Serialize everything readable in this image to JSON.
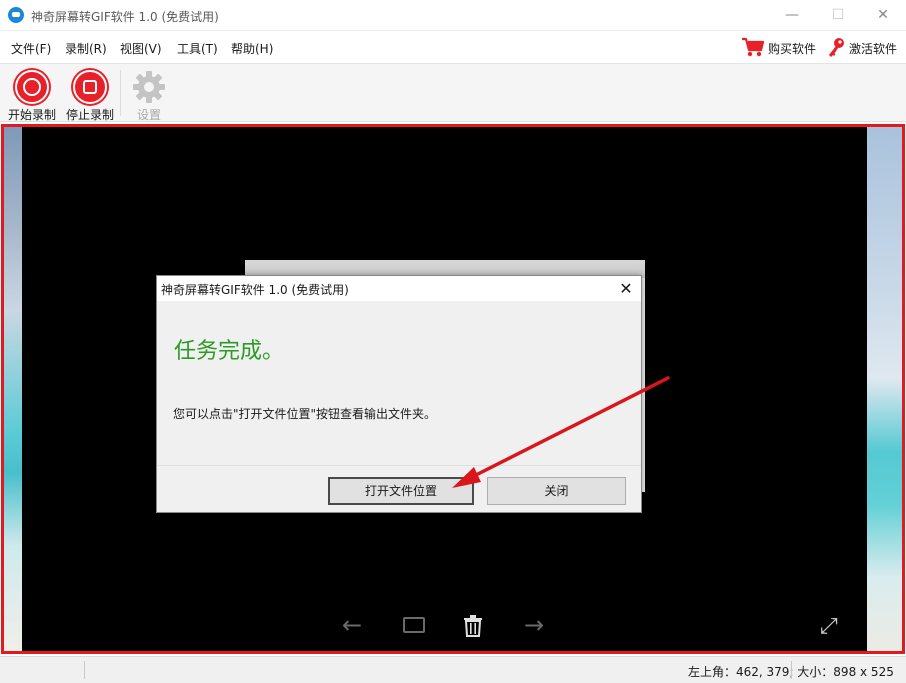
{
  "window": {
    "title": "神奇屏幕转GIF软件 1.0 (免费试用)",
    "minimize_glyph": "—",
    "maximize_glyph": "☐",
    "close_glyph": "✕"
  },
  "menu": {
    "file": "文件(F)",
    "record": "录制(R)",
    "view": "视图(V)",
    "tools": "工具(T)",
    "help": "帮助(H)",
    "buy": "购买软件",
    "activate": "激活软件"
  },
  "toolbar": {
    "start": "开始录制",
    "stop": "停止录制",
    "settings": "设置"
  },
  "dialog": {
    "title": "神奇屏幕转GIF软件 1.0 (免费试用)",
    "heading": "任务完成。",
    "message": "您可以点击\"打开文件位置\"按钮查看输出文件夹。",
    "open_folder": "打开文件位置",
    "close": "关闭"
  },
  "nav": {
    "prev_glyph": "←",
    "next_glyph": "→",
    "fullscreen_glyph": "⤢"
  },
  "status": {
    "text": "左上角：462, 379; 大小：898 x 525"
  },
  "colors": {
    "record_red": "#e8202a",
    "frame_red": "#e3191f",
    "heading_green": "#2e9a26"
  },
  "icons": [
    "app-icon",
    "cart-icon",
    "key-icon",
    "start-record-icon",
    "stop-record-icon",
    "gear-icon",
    "arrow-left-icon",
    "frame-icon",
    "trash-icon",
    "arrow-right-icon",
    "fullscreen-icon",
    "close-icon"
  ]
}
